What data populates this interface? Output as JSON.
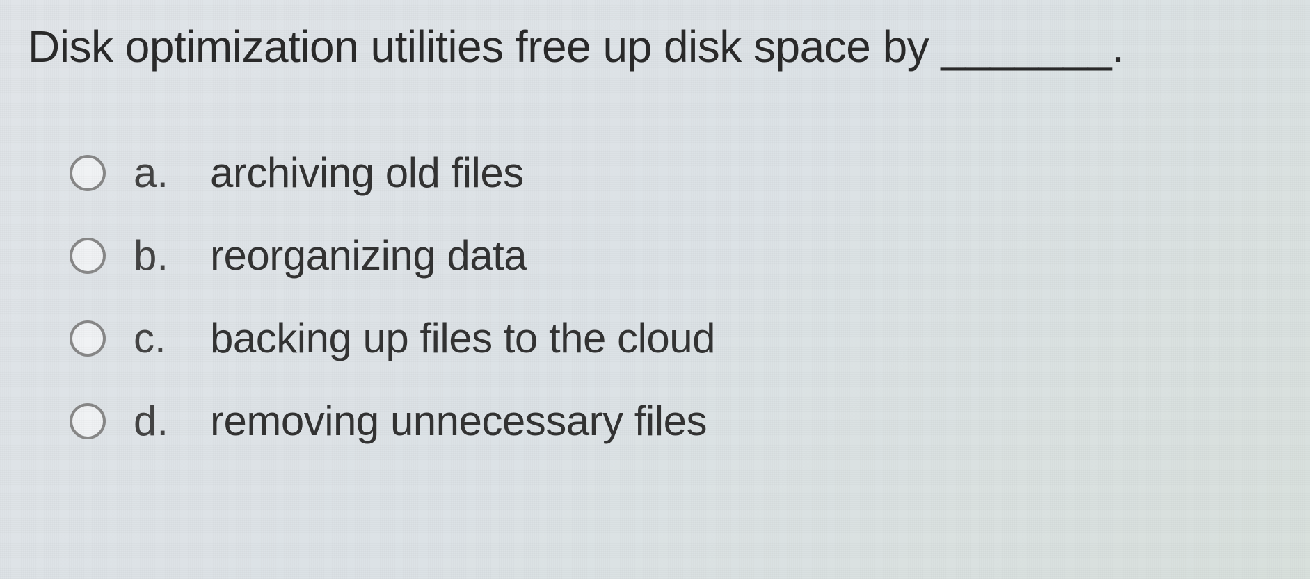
{
  "question": {
    "text": "Disk optimization utilities free up disk space by _______."
  },
  "options": [
    {
      "letter": "a.",
      "text": "archiving old files"
    },
    {
      "letter": "b.",
      "text": "reorganizing data"
    },
    {
      "letter": "c.",
      "text": "backing up files to the cloud"
    },
    {
      "letter": "d.",
      "text": "removing unnecessary files"
    }
  ]
}
